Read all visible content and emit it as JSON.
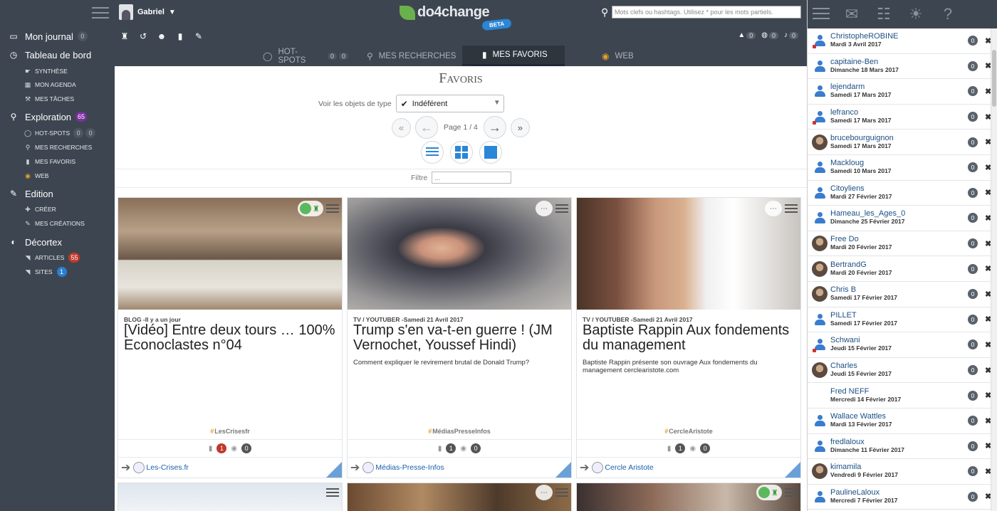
{
  "user": {
    "name": "Gabriel"
  },
  "brand": {
    "name": "do4change",
    "beta": "BETA"
  },
  "search": {
    "placeholder": "Mots clefs ou hashtags. Utilisez * pour les mots partiels."
  },
  "sidebar": {
    "journal": {
      "label": "Mon journal",
      "count": "0"
    },
    "dashboard": {
      "label": "Tableau de bord"
    },
    "dashboard_items": [
      "Synthèse",
      "Mon agenda",
      "Mes tâches"
    ],
    "exploration": {
      "label": "Exploration",
      "count": "65"
    },
    "exploration_items": [
      {
        "label": "Hot-spots",
        "c1": "0",
        "c2": "0"
      },
      {
        "label": "Mes recherches"
      },
      {
        "label": "Mes favoris"
      },
      {
        "label": "Web"
      }
    ],
    "edition": {
      "label": "Edition"
    },
    "edition_items": [
      "Créer",
      "Mes créations"
    ],
    "decortex": {
      "label": "Décortex"
    },
    "decortex_items": [
      {
        "label": "Articles",
        "count": "55"
      },
      {
        "label": "Sites",
        "count": "1"
      }
    ]
  },
  "topbar": {
    "notif_counts": [
      "0",
      "0",
      "0"
    ],
    "tabs": [
      {
        "label": "Hot-spots",
        "c1": "0",
        "c2": "0"
      },
      {
        "label": "Mes recherches"
      },
      {
        "label": "Mes favoris"
      },
      {
        "label": "Web"
      }
    ],
    "active_tab": "Mes favoris"
  },
  "main": {
    "title": "Favoris",
    "type_label": "Voir les objets de type",
    "type_value": "Indéférent",
    "page_label": "Page 1 / 4",
    "filter_label": "Filtre",
    "filter_placeholder": "..."
  },
  "cards": [
    {
      "category": "Blog",
      "date": "Il y a un jour",
      "title": "[Vidéo] Entre deux tours … 100% Econoclastes n°04",
      "description": "",
      "tag": "LesCrisesfr",
      "bookmarks": "1",
      "views": "0",
      "source": "Les-Crises.fr"
    },
    {
      "category": "TV / Youtuber",
      "date": "Samedi 21 Avril 2017",
      "title": "Trump s'en va-t-en guerre ! (JM Vernochet, Youssef Hindi)",
      "description": "Comment expliquer le revirement brutal de Donald Trump?",
      "tag": "MédiasPresseInfos",
      "bookmarks": "1",
      "views": "0",
      "source": "Médias-Presse-Infos"
    },
    {
      "category": "TV / Youtuber",
      "date": "Samedi 21 Avril 2017",
      "title": "Baptiste Rappin Aux fondements du management",
      "description": "Baptiste Rappin présente son ouvrage Aux fondements du management cerclearistote.com",
      "tag": "CercleAristote",
      "bookmarks": "1",
      "views": "0",
      "source": "Cercle Aristote"
    }
  ],
  "contacts": [
    {
      "name": "ChristopheROBINE",
      "date": "Mardi 3 Avril 2017",
      "count": "0",
      "avatar": "default",
      "mark": true
    },
    {
      "name": "capitaine-Ben",
      "date": "Dimanche 18 Mars 2017",
      "count": "0",
      "avatar": "default"
    },
    {
      "name": "lejendarm",
      "date": "Samedi 17 Mars 2017",
      "count": "0",
      "avatar": "default"
    },
    {
      "name": "lefranco",
      "date": "Samedi 17 Mars 2017",
      "count": "0",
      "avatar": "default",
      "mark": true
    },
    {
      "name": "brucebourguignon",
      "date": "Samedi 17 Mars 2017",
      "count": "0",
      "avatar": "photo"
    },
    {
      "name": "Mackloug",
      "date": "Samedi 10 Mars 2017",
      "count": "0",
      "avatar": "default"
    },
    {
      "name": "Citoyliens",
      "date": "Mardi 27 Février 2017",
      "count": "0",
      "avatar": "default"
    },
    {
      "name": "Hameau_les_Ages_0",
      "date": "Dimanche 25 Février 2017",
      "count": "0",
      "avatar": "default"
    },
    {
      "name": "Free Do",
      "date": "Mardi 20 Février 2017",
      "count": "0",
      "avatar": "photo"
    },
    {
      "name": "BertrandG",
      "date": "Mardi 20 Février 2017",
      "count": "0",
      "avatar": "photo"
    },
    {
      "name": "Chris B",
      "date": "Samedi 17 Février 2017",
      "count": "0",
      "avatar": "photo"
    },
    {
      "name": "PILLET",
      "date": "Samedi 17 Février 2017",
      "count": "0",
      "avatar": "default"
    },
    {
      "name": "Schwani",
      "date": "Jeudi 15 Février 2017",
      "count": "0",
      "avatar": "default",
      "mark": true
    },
    {
      "name": "Charles",
      "date": "Jeudi 15 Février 2017",
      "count": "0",
      "avatar": "photo"
    },
    {
      "name": "Fred NEFF",
      "date": "Mercredi 14 Février 2017",
      "count": "0",
      "avatar": "none"
    },
    {
      "name": "Wallace Wattles",
      "date": "Mardi 13 Février 2017",
      "count": "0",
      "avatar": "default"
    },
    {
      "name": "fredlaloux",
      "date": "Dimanche 11 Février 2017",
      "count": "0",
      "avatar": "default"
    },
    {
      "name": "kimamila",
      "date": "Vendredi 9 Février 2017",
      "count": "0",
      "avatar": "photo"
    },
    {
      "name": "PaulineLaloux",
      "date": "Mercredi 7 Février 2017",
      "count": "0",
      "avatar": "default"
    }
  ]
}
